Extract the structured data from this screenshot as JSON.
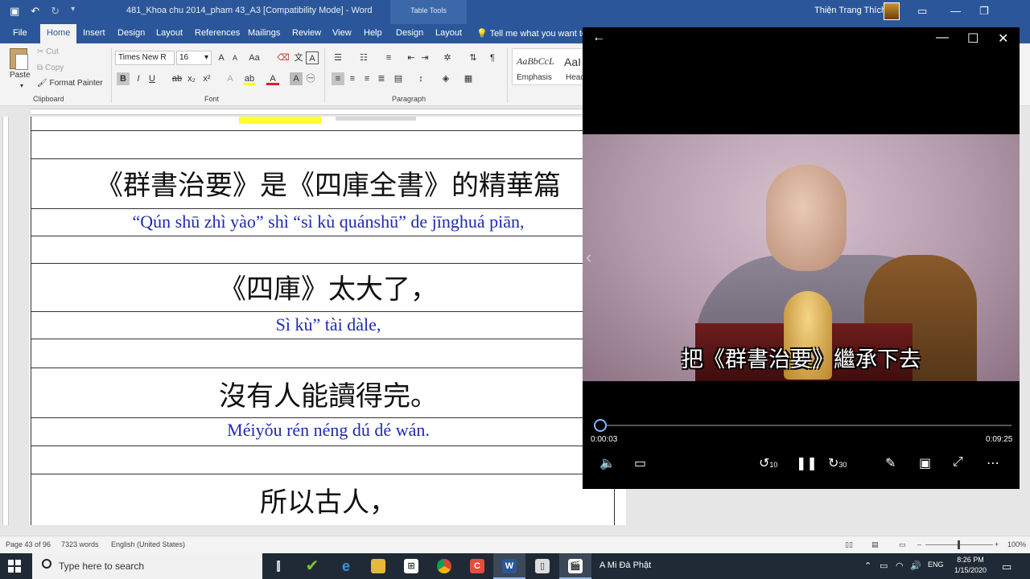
{
  "titlebar": {
    "doc_title": "481_Khoa chu 2014_pham 43_A3 [Compatibility Mode]  -  Word",
    "table_tools": "Table Tools",
    "user": "Thiện Trang Thích",
    "minimize": "—",
    "restore": "❐",
    "close": "✕"
  },
  "ribbon_tabs": [
    "File",
    "Home",
    "Insert",
    "Design",
    "Layout",
    "References",
    "Mailings",
    "Review",
    "View",
    "Help",
    "Design",
    "Layout"
  ],
  "tell_me": "Tell me what you want to",
  "clipboard": {
    "paste": "Paste",
    "cut": "Cut",
    "copy": "Copy",
    "format_painter": "Format Painter",
    "label": "Clipboard"
  },
  "font": {
    "family": "Times New R",
    "size": "16",
    "label": "Font"
  },
  "paragraph": {
    "label": "Paragraph"
  },
  "styles": {
    "sample1": "AaBbCcL",
    "sample2": "AaI",
    "name1": "Emphasis",
    "name2": "Head"
  },
  "document": {
    "rows": [
      {
        "type": "cn",
        "text": "《群書治要》是《四庫全書》的精華篇"
      },
      {
        "type": "py",
        "text": "“Qún shū zhì yào” shì “sì kù quánshū” de jīnghuá piān,"
      },
      {
        "type": "cn",
        "text": "《四庫》太大了，"
      },
      {
        "type": "py",
        "text": "Sì kù” tài dàle,"
      },
      {
        "type": "cn",
        "text": "沒有人能讀得完。"
      },
      {
        "type": "py",
        "text": "Méiyǒu rén néng dú dé wán."
      },
      {
        "type": "cn",
        "text": "所以古人，"
      }
    ]
  },
  "status": {
    "page": "Page 43 of 96",
    "words": "7323 words",
    "language": "English (United States)",
    "zoom": "100%"
  },
  "taskbar": {
    "search_placeholder": "Type here to search",
    "active_window": "A Mi Đà Phật",
    "lang": "ENG",
    "time": "8:26 PM",
    "date": "1/15/2020"
  },
  "player": {
    "subtitle": "把《群書治要》繼承下去",
    "elapsed": "0:00:03",
    "total": "0:09:25",
    "progress": 0.005,
    "skip_back": "10",
    "skip_forward": "30"
  }
}
